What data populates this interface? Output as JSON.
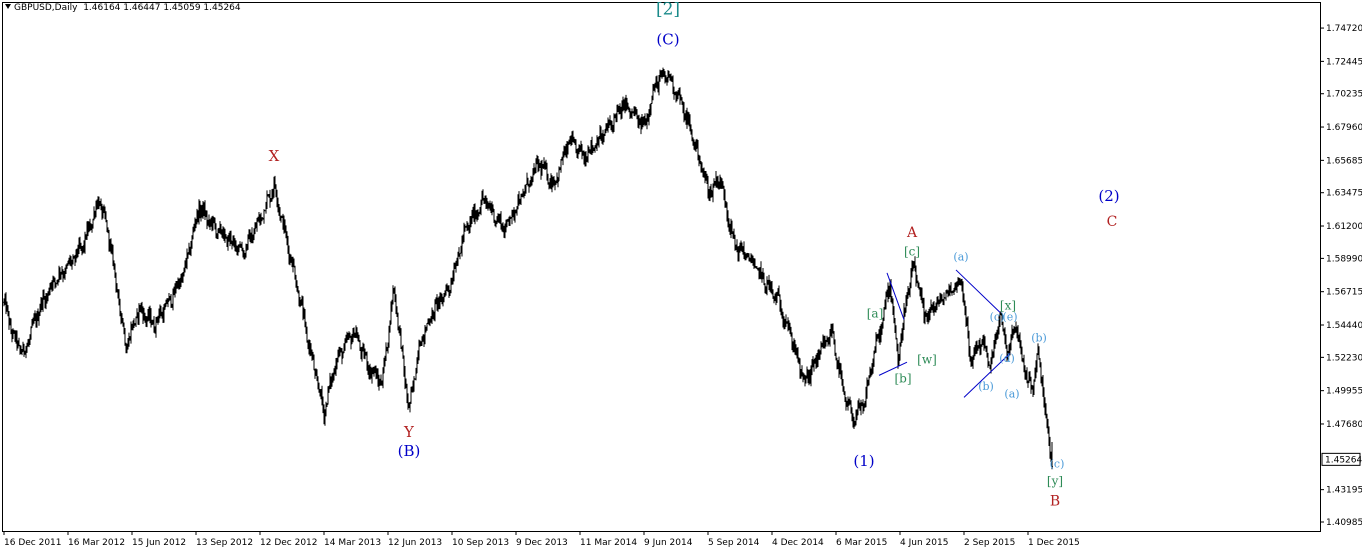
{
  "header": {
    "symbol": "GBPUSD,Daily",
    "ohlc": "1.46164 1.46447 1.45059 1.45264"
  },
  "colors": {
    "candle": "#000000",
    "axis": "#000000",
    "blue": "#0000c8",
    "teal": "#1a8a8a",
    "red": "#b22222",
    "green": "#2e8b57",
    "cyan": "#4a9ad8",
    "price_box_bg": "#ffffff"
  },
  "chart_data": {
    "type": "ohlc",
    "symbol": "GBPUSD",
    "timeframe": "Daily",
    "current_price": 1.45264,
    "y_ticks": [
      1.7472,
      1.72445,
      1.70235,
      1.6796,
      1.65685,
      1.63475,
      1.612,
      1.5899,
      1.56715,
      1.5444,
      1.5223,
      1.49955,
      1.4768,
      1.43195,
      1.40985
    ],
    "y_tick_labels": [
      "1.74720",
      "1.72445",
      "1.70235",
      "1.67960",
      "1.65685",
      "1.63475",
      "1.61200",
      "1.58990",
      "1.56715",
      "1.54440",
      "1.52230",
      "1.49955",
      "1.47680",
      "1.43195",
      "1.40985"
    ],
    "x_tick_labels": [
      "16 Dec 2011",
      "16 Mar 2012",
      "15 Jun 2012",
      "13 Sep 2012",
      "12 Dec 2012",
      "14 Mar 2013",
      "12 Jun 2013",
      "10 Sep 2013",
      "9 Dec 2013",
      "11 Mar 2014",
      "9 Jun 2014",
      "5 Sep 2014",
      "4 Dec 2014",
      "6 Mar 2015",
      "4 Jun 2015",
      "2 Sep 2015",
      "1 Dec 2015"
    ],
    "x_tick_index": [
      0,
      64,
      128,
      192,
      256,
      320,
      384,
      448,
      512,
      576,
      640,
      704,
      768,
      832,
      896,
      960,
      1024
    ],
    "bars_total": 1048,
    "ylim": [
      1.40985,
      1.765
    ],
    "grid": false,
    "price_path": [
      [
        0,
        1.56
      ],
      [
        10,
        1.535
      ],
      [
        20,
        1.525
      ],
      [
        35,
        1.555
      ],
      [
        50,
        1.575
      ],
      [
        65,
        1.585
      ],
      [
        80,
        1.6
      ],
      [
        95,
        1.63
      ],
      [
        105,
        1.605
      ],
      [
        115,
        1.56
      ],
      [
        122,
        1.53
      ],
      [
        135,
        1.555
      ],
      [
        150,
        1.545
      ],
      [
        165,
        1.56
      ],
      [
        180,
        1.58
      ],
      [
        195,
        1.625
      ],
      [
        205,
        1.615
      ],
      [
        220,
        1.605
      ],
      [
        240,
        1.595
      ],
      [
        255,
        1.615
      ],
      [
        270,
        1.64
      ],
      [
        280,
        1.61
      ],
      [
        292,
        1.575
      ],
      [
        305,
        1.53
      ],
      [
        320,
        1.485
      ],
      [
        332,
        1.52
      ],
      [
        350,
        1.54
      ],
      [
        365,
        1.515
      ],
      [
        378,
        1.505
      ],
      [
        390,
        1.57
      ],
      [
        405,
        1.485
      ],
      [
        415,
        1.53
      ],
      [
        430,
        1.555
      ],
      [
        445,
        1.57
      ],
      [
        462,
        1.61
      ],
      [
        480,
        1.63
      ],
      [
        500,
        1.61
      ],
      [
        520,
        1.635
      ],
      [
        535,
        1.655
      ],
      [
        550,
        1.64
      ],
      [
        565,
        1.67
      ],
      [
        580,
        1.66
      ],
      [
        600,
        1.675
      ],
      [
        620,
        1.695
      ],
      [
        640,
        1.68
      ],
      [
        652,
        1.71
      ],
      [
        664,
        1.715
      ],
      [
        675,
        1.7
      ],
      [
        690,
        1.67
      ],
      [
        705,
        1.635
      ],
      [
        716,
        1.645
      ],
      [
        730,
        1.6
      ],
      [
        745,
        1.59
      ],
      [
        760,
        1.575
      ],
      [
        775,
        1.56
      ],
      [
        788,
        1.535
      ],
      [
        800,
        1.505
      ],
      [
        812,
        1.52
      ],
      [
        828,
        1.54
      ],
      [
        840,
        1.495
      ],
      [
        850,
        1.48
      ],
      [
        860,
        1.49
      ],
      [
        870,
        1.525
      ],
      [
        878,
        1.545
      ],
      [
        886,
        1.575
      ],
      [
        894,
        1.52
      ],
      [
        902,
        1.56
      ],
      [
        910,
        1.585
      ],
      [
        920,
        1.55
      ],
      [
        935,
        1.56
      ],
      [
        950,
        1.57
      ],
      [
        958,
        1.575
      ],
      [
        966,
        1.52
      ],
      [
        978,
        1.535
      ],
      [
        986,
        1.515
      ],
      [
        996,
        1.55
      ],
      [
        1004,
        1.525
      ],
      [
        1012,
        1.545
      ],
      [
        1020,
        1.515
      ],
      [
        1028,
        1.5
      ],
      [
        1034,
        1.525
      ],
      [
        1040,
        1.495
      ],
      [
        1046,
        1.46
      ],
      [
        1048,
        1.4526
      ]
    ],
    "wave_labels": [
      {
        "text": "[2]",
        "color_key": "teal",
        "bar": 664,
        "price": 1.7565,
        "size": 17
      },
      {
        "text": "(C)",
        "color_key": "blue",
        "bar": 664,
        "price": 1.736,
        "size": 15
      },
      {
        "text": "X",
        "color_key": "red",
        "bar": 270,
        "price": 1.6565,
        "size": 15
      },
      {
        "text": "Y",
        "color_key": "red",
        "bar": 405,
        "price": 1.468,
        "size": 15
      },
      {
        "text": "(B)",
        "color_key": "blue",
        "bar": 405,
        "price": 1.455,
        "size": 15
      },
      {
        "text": "A",
        "color_key": "red",
        "bar": 908,
        "price": 1.6045,
        "size": 14
      },
      {
        "text": "[c]",
        "color_key": "green",
        "bar": 908,
        "price": 1.592,
        "size": 12
      },
      {
        "text": "[a]",
        "color_key": "green",
        "bar": 871,
        "price": 1.5495,
        "size": 12
      },
      {
        "text": "[b]",
        "color_key": "green",
        "bar": 899,
        "price": 1.505,
        "size": 12
      },
      {
        "text": "[w]",
        "color_key": "green",
        "bar": 923,
        "price": 1.518,
        "size": 12
      },
      {
        "text": "[x]",
        "color_key": "green",
        "bar": 1004,
        "price": 1.555,
        "size": 12
      },
      {
        "text": "[y]",
        "color_key": "green",
        "bar": 1051,
        "price": 1.435,
        "size": 12
      },
      {
        "text": "(1)",
        "color_key": "blue",
        "bar": 860,
        "price": 1.448,
        "size": 15
      },
      {
        "text": "(2)",
        "color_key": "blue",
        "bar": 1105,
        "price": 1.629,
        "size": 15
      },
      {
        "text": "C",
        "color_key": "red",
        "bar": 1108,
        "price": 1.612,
        "size": 14
      },
      {
        "text": "B",
        "color_key": "red",
        "bar": 1051,
        "price": 1.421,
        "size": 14
      },
      {
        "text": "(a)",
        "color_key": "cyan",
        "bar": 957,
        "price": 1.5885,
        "size": 11
      },
      {
        "text": "(b)",
        "color_key": "cyan",
        "bar": 982,
        "price": 1.5,
        "size": 11
      },
      {
        "text": "(c)",
        "color_key": "cyan",
        "bar": 993,
        "price": 1.5475,
        "size": 11
      },
      {
        "text": "(e)",
        "color_key": "cyan",
        "bar": 1006,
        "price": 1.5475,
        "size": 11
      },
      {
        "text": "(d)",
        "color_key": "cyan",
        "bar": 1003,
        "price": 1.519,
        "size": 11
      },
      {
        "text": "(a)",
        "color_key": "cyan",
        "bar": 1008,
        "price": 1.495,
        "size": 11
      },
      {
        "text": "(b)",
        "color_key": "cyan",
        "bar": 1035,
        "price": 1.533,
        "size": 11
      },
      {
        "text": "(c)",
        "color_key": "cyan",
        "bar": 1053,
        "price": 1.447,
        "size": 11
      }
    ],
    "trend_lines": [
      {
        "from": [
          875,
          1.51
        ],
        "to": [
          903,
          1.519
        ]
      },
      {
        "from": [
          883,
          1.58
        ],
        "to": [
          900,
          1.548
        ]
      },
      {
        "from": [
          952,
          1.582
        ],
        "to": [
          996,
          1.553
        ]
      },
      {
        "from": [
          960,
          1.495
        ],
        "to": [
          1006,
          1.525
        ]
      }
    ]
  }
}
